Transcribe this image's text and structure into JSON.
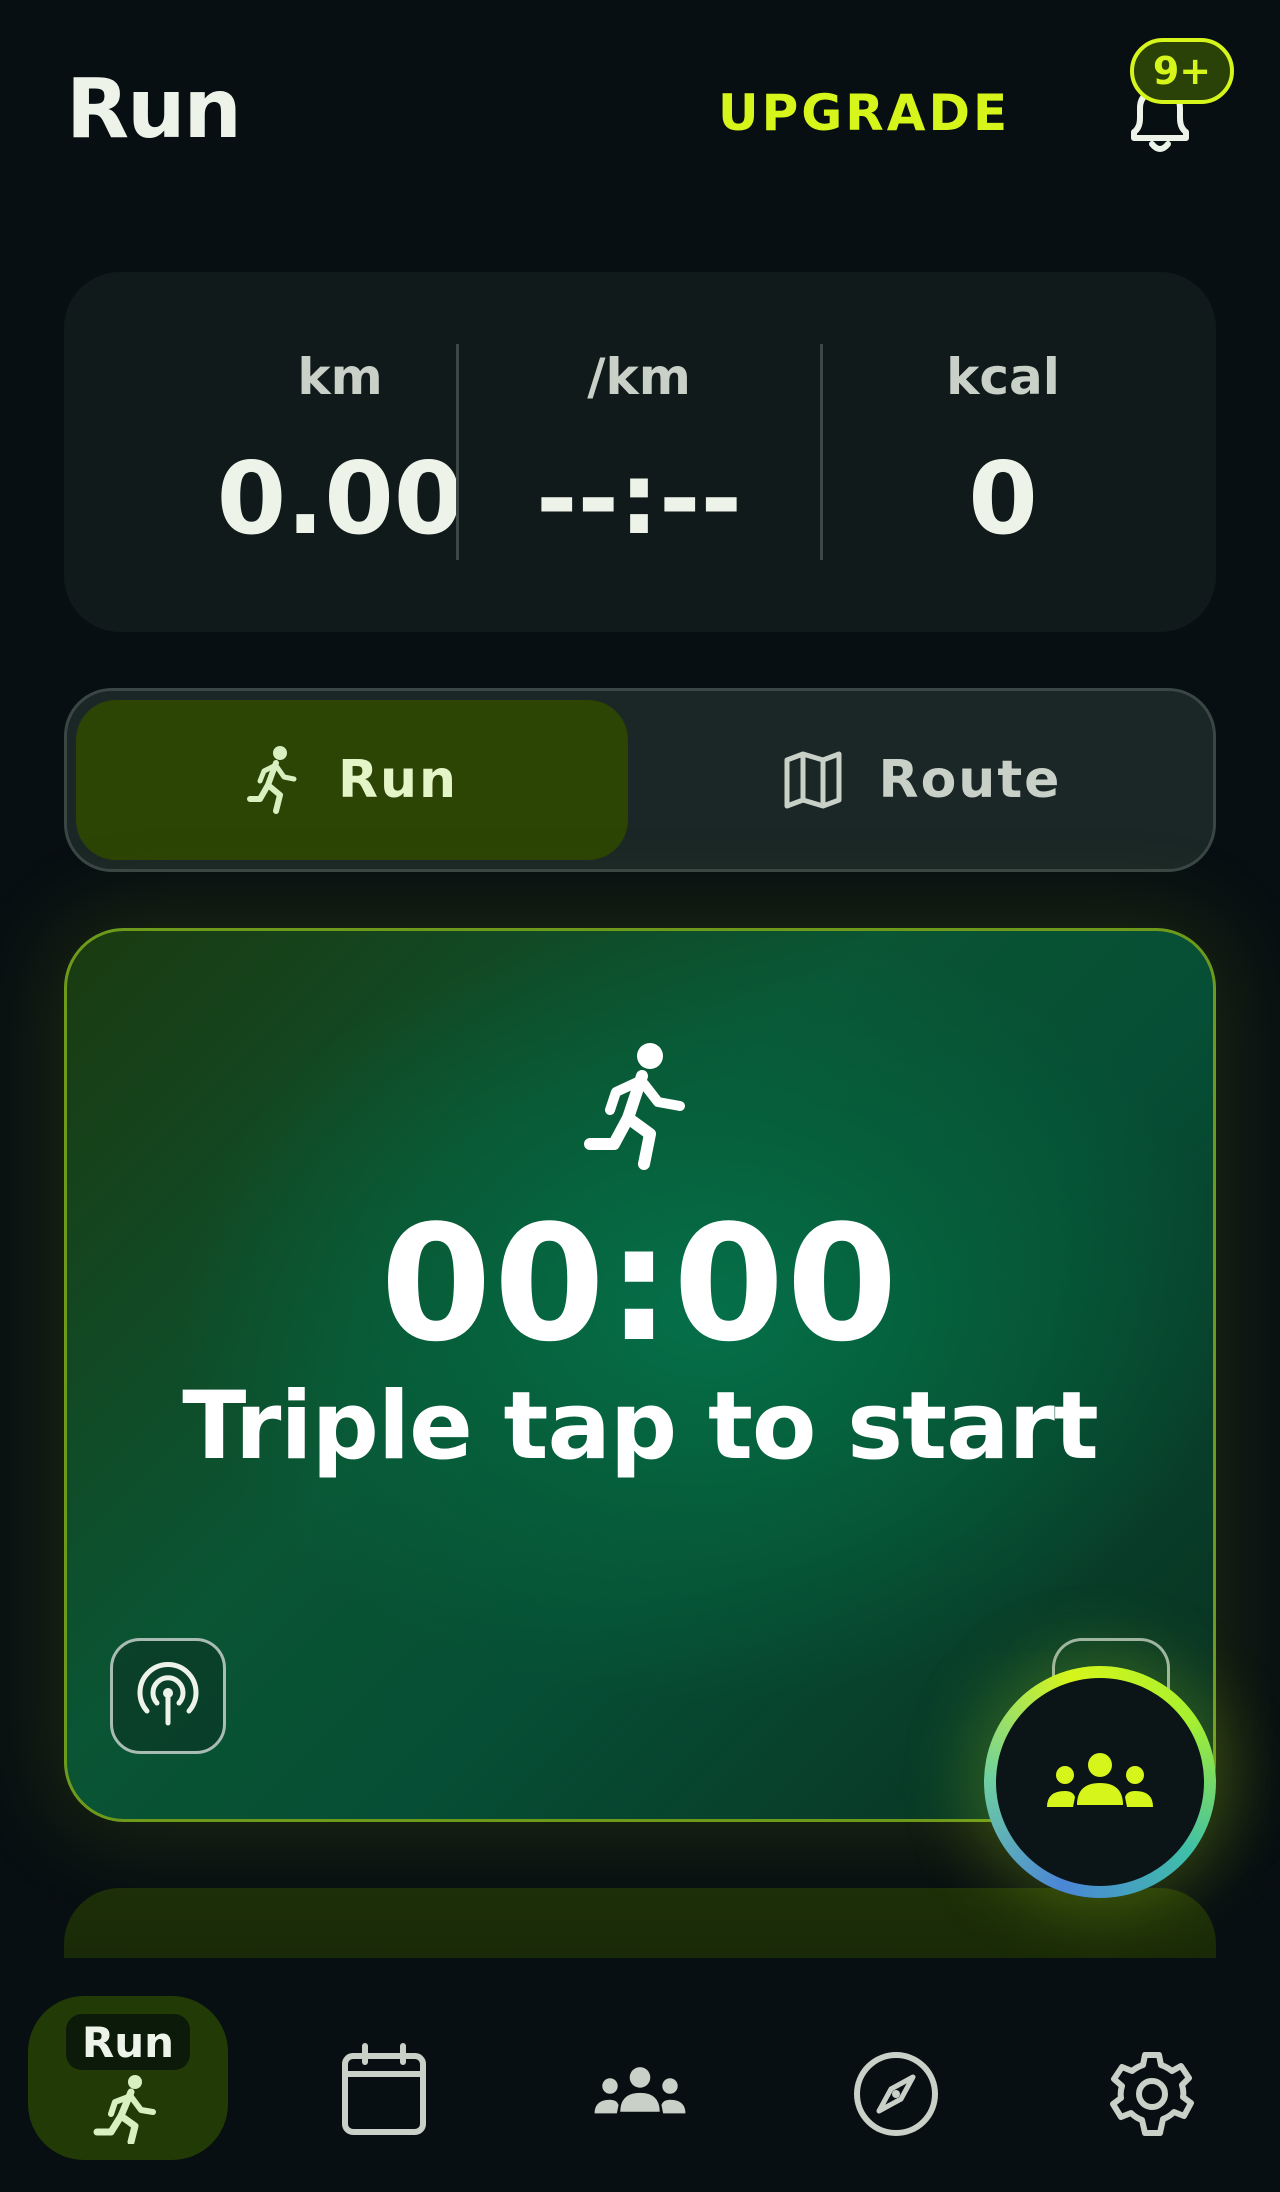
{
  "header": {
    "title": "Run",
    "upgrade_label": "UPGRADE",
    "notification_badge": "9+"
  },
  "stats": [
    {
      "label": "km",
      "value": "0.00"
    },
    {
      "label": "/km",
      "value": "--:--"
    },
    {
      "label": "kcal",
      "value": "0"
    }
  ],
  "mode_toggle": {
    "run_label": "Run",
    "route_label": "Route",
    "selected": "Run"
  },
  "main_card": {
    "timer": "00:00",
    "hint": "Triple tap to start"
  },
  "bottom_nav": {
    "items": [
      {
        "icon": "runner-icon",
        "label": "Run",
        "active": true
      },
      {
        "icon": "calendar-icon",
        "active": false
      },
      {
        "icon": "group-icon",
        "active": false
      },
      {
        "icon": "compass-icon",
        "active": false
      },
      {
        "icon": "gear-icon",
        "active": false
      }
    ]
  },
  "colors": {
    "accent": "#d6f51a",
    "background": "#080f12",
    "active_green": "#2c4404"
  }
}
